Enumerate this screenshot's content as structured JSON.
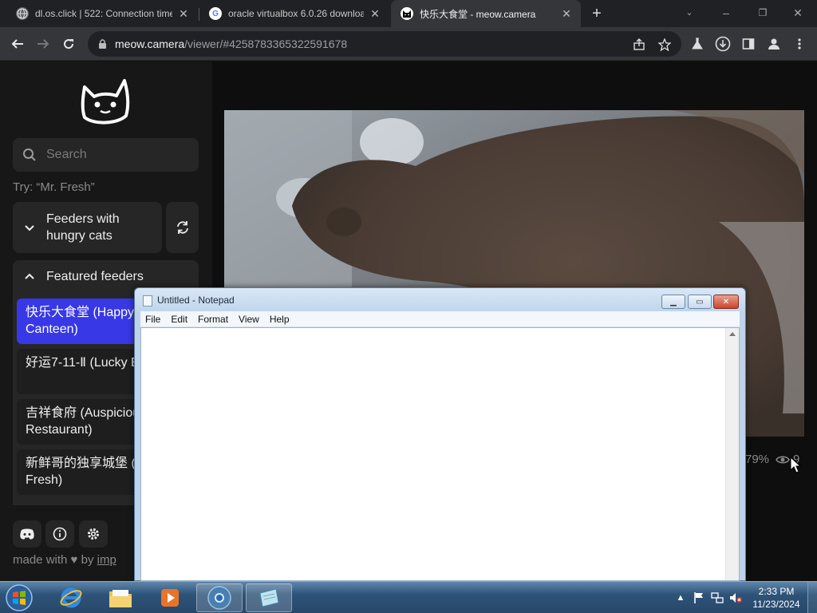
{
  "browser": {
    "tabs": [
      {
        "title": "dl.os.click | 522: Connection time",
        "favicon": "globe-icon",
        "active": false
      },
      {
        "title": "oracle virtualbox 6.0.26 downloa",
        "favicon": "google-icon",
        "active": false
      },
      {
        "title": "快乐大食堂 - meow.camera",
        "favicon": "cat-logo-icon",
        "active": true
      }
    ],
    "url_host": "meow.camera",
    "url_path": "/viewer/#4258783365322591678"
  },
  "sidebar": {
    "search_placeholder": "Search",
    "try_hint": "Try: “Mr. Fresh”",
    "feeders_with_hungry_cats": "Feeders with hungry cats",
    "featured_feeders": "Featured feeders",
    "feeders": [
      {
        "name": "快乐大食堂 (Happy Canteen)",
        "active": true
      },
      {
        "name": "好运7-11-Ⅱ (Lucky Eleven II)",
        "active": false
      },
      {
        "name": "吉祥食府 (Auspicious Restaurant)",
        "active": false
      },
      {
        "name": "新鲜哥的独享城堡 (Mr. Fresh)",
        "active": false
      }
    ],
    "made_with": "made with",
    "by": "by",
    "author_link": "imp"
  },
  "viewer": {
    "percent": "79%",
    "viewers": "9"
  },
  "notepad": {
    "title": "Untitled - Notepad",
    "menus": [
      "File",
      "Edit",
      "Format",
      "View",
      "Help"
    ]
  },
  "taskbar": {
    "time": "2:33 PM",
    "date": "11/23/2024",
    "pinned": [
      "internet-explorer-icon",
      "file-explorer-icon",
      "media-player-icon",
      "chrome-icon",
      "notepad-icon"
    ]
  },
  "colors": {
    "active_feeder": "#3838e6",
    "sidebar_bg": "#171717",
    "taskbar": "#2e5378"
  }
}
